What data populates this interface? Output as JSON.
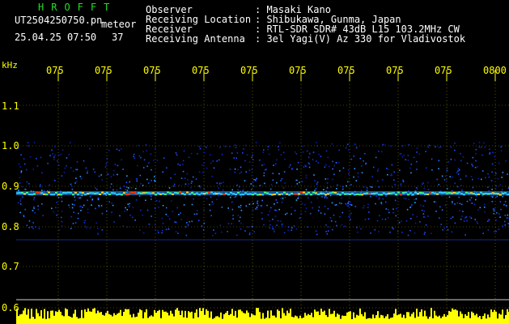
{
  "header": {
    "brand": "HROFFT",
    "filename": "UT2504250750.pn",
    "meteor_label": "meteor",
    "datetime": "25.04.25 07:50",
    "count": "37",
    "info": [
      {
        "label": "Observer",
        "value": ": Masaki Kano"
      },
      {
        "label": "Receiving Location",
        "value": ": Shibukawa, Gunma, Japan"
      },
      {
        "label": "Receiver",
        "value": ": RTL-SDR SDR# 43dB L15 103.2MHz CW"
      },
      {
        "label": "Receiving Antenna",
        "value": ": 3el Yagi(V) Az 330 for Vladivostok"
      }
    ]
  },
  "axis": {
    "unit": "kHz",
    "time_ticks": [
      "075",
      "075",
      "075",
      "075",
      "075",
      "075",
      "075",
      "075",
      "075",
      "0800"
    ],
    "freq_ticks": [
      "1.1",
      "1.0",
      "0.9",
      "0.8",
      "0.7",
      "0.6"
    ]
  },
  "colors": {
    "text_green": "#20e020",
    "text_yellow": "#ffff00",
    "text_white": "#ffffff",
    "grid_yellow": "#ffff00",
    "noise_blue": "#1030d0",
    "echo_red": "#ff3000"
  }
}
